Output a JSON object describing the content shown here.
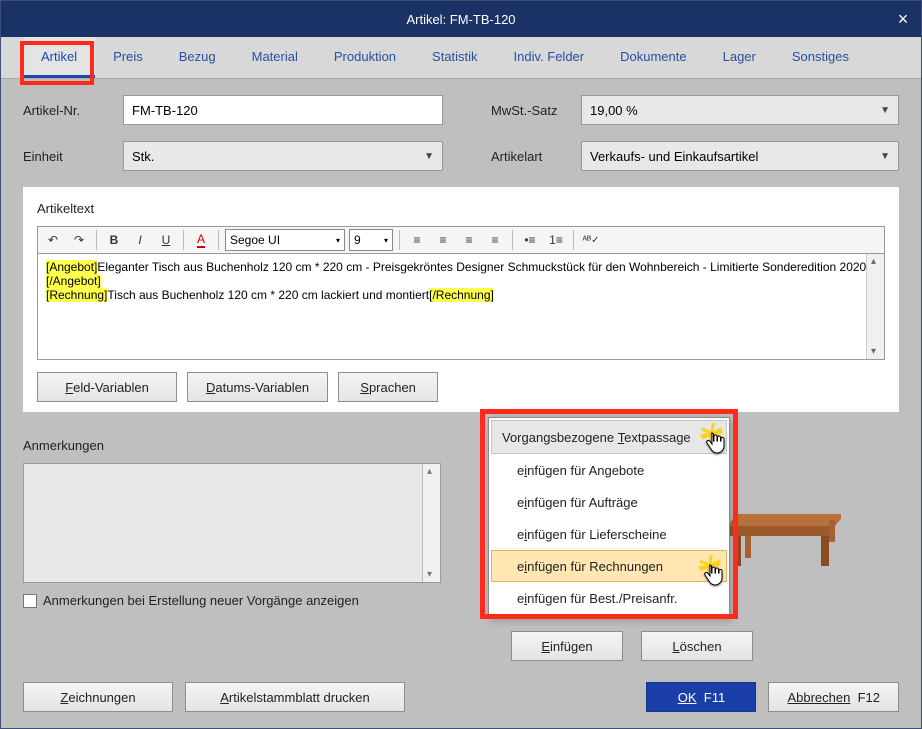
{
  "title": "Artikel: FM-TB-120",
  "tabs": [
    "Artikel",
    "Preis",
    "Bezug",
    "Material",
    "Produktion",
    "Statistik",
    "Indiv. Felder",
    "Dokumente",
    "Lager",
    "Sonstiges"
  ],
  "fields": {
    "artnr_label": "Artikel-Nr.",
    "artnr_value": "FM-TB-120",
    "einheit_label": "Einheit",
    "einheit_value": "Stk.",
    "mwst_label": "MwSt.-Satz",
    "mwst_value": "19,00 %",
    "art_label": "Artikelart",
    "art_value": "Verkaufs- und Einkaufsartikel"
  },
  "rte": {
    "label": "Artikeltext",
    "font": "Segoe UI",
    "size": "9",
    "tags": {
      "ang_open": "[Angebot]",
      "ang_close": "[/Angebot]",
      "rech_open": "[Rechnung]",
      "rech_close": "[/Rechnung]"
    },
    "line1_text": "Eleganter Tisch aus Buchenholz 120 cm * 220 cm - Preisgekröntes Designer Schmuckstück für den Wohnbereich - Limitierte Sonderedition 2020",
    "line2_text": "Tisch aus Buchenholz  120 cm * 220 cm lackiert und montiert"
  },
  "buttons": {
    "feldvar": "Feld-Variablen",
    "datvar": "Datums-Variablen",
    "sprachen": "Sprachen",
    "vtp": "Vorgangsbezogene Textpassage"
  },
  "menu": {
    "items": [
      "einfügen für Angebote",
      "einfügen für Aufträge",
      "einfügen für Lieferscheine",
      "einfügen für Rechnungen",
      "einfügen für Best./Preisanfr."
    ]
  },
  "notes": {
    "label": "Anmerkungen"
  },
  "checkbox": "Anmerkungen bei Erstellung neuer Vorgänge anzeigen",
  "actions": {
    "einf": "Einfügen",
    "del": "Löschen",
    "zeich": "Zeichnungen",
    "stamm": "Artikelstammblatt drucken",
    "ok": "OK",
    "okF": "F11",
    "cancel": "Abbrechen",
    "cancelF": "F12"
  }
}
